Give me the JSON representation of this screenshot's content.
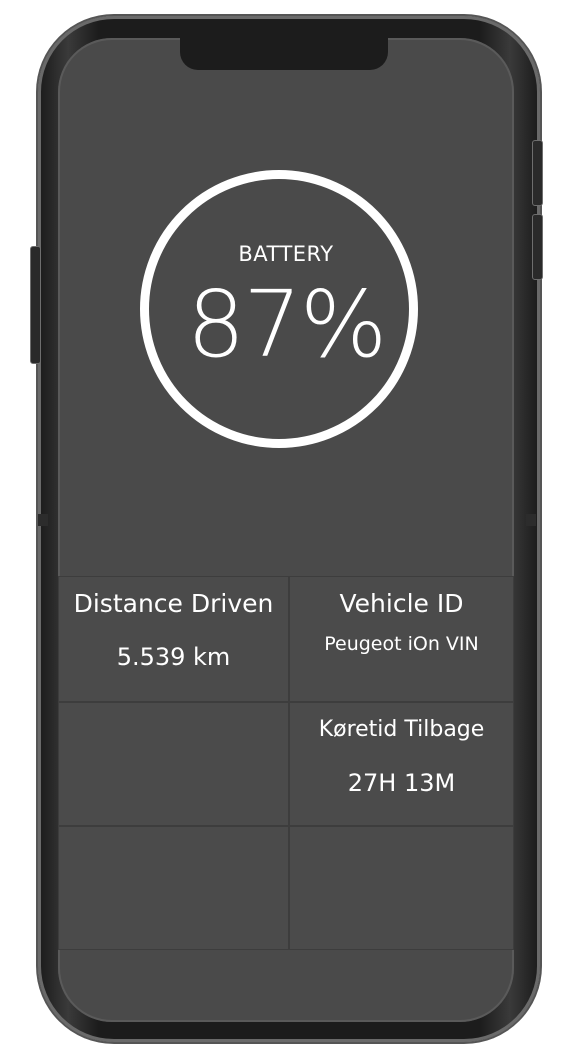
{
  "battery": {
    "label": "BATTERY",
    "value_text": "87%",
    "percent": 87
  },
  "tiles": {
    "distance": {
      "title": "Distance Driven",
      "value": "5.539 km"
    },
    "vehicle": {
      "title": "Vehicle ID",
      "value": "Peugeot iOn VIN"
    },
    "time_left": {
      "title": "Køretid Tilbage",
      "value": "27H 13M"
    }
  },
  "colors": {
    "screen_background": "#4a4a4a",
    "tile_background": "#4b4b4b",
    "text": "#ffffff",
    "phone_frame": "#1c1c1c"
  }
}
